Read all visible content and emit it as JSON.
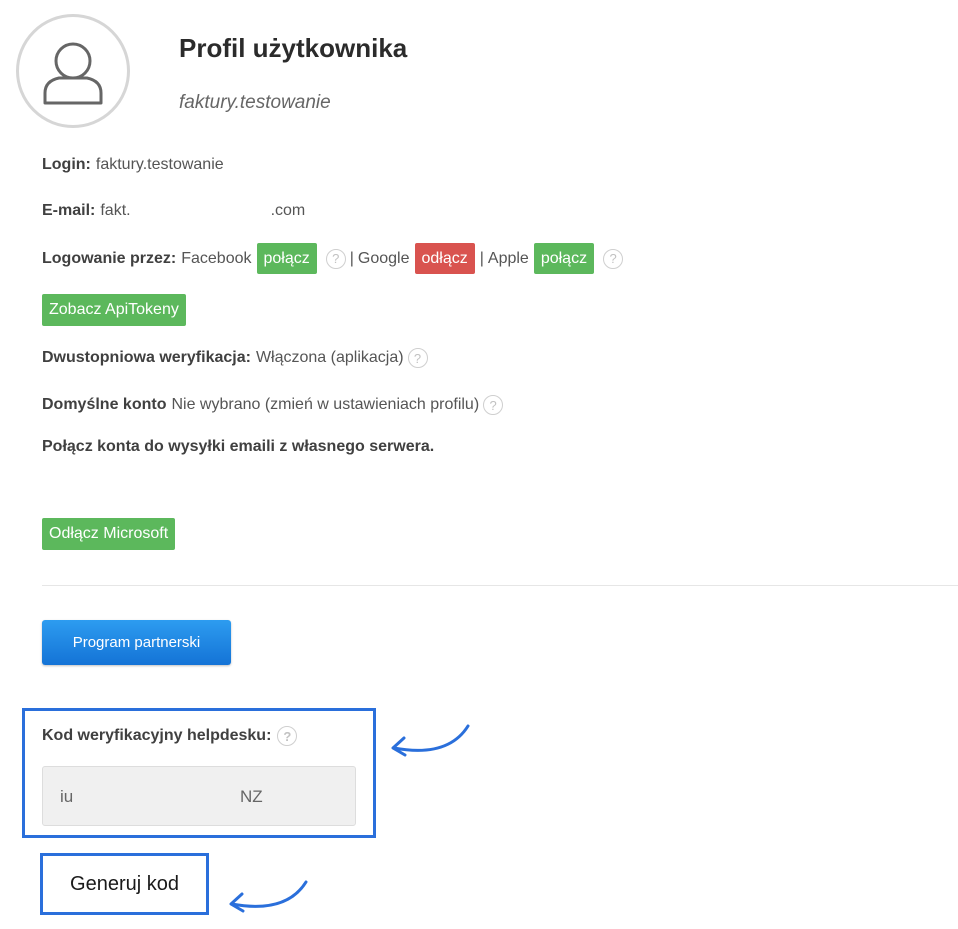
{
  "profile": {
    "title": "Profil użytkownika",
    "username": "faktury.testowanie"
  },
  "login": {
    "label": "Login:",
    "value": "faktury.testowanie"
  },
  "email": {
    "label": "E-mail:",
    "value_start": "fakt.",
    "value_end": ".com"
  },
  "social_login": {
    "label": "Logowanie przez:",
    "facebook": {
      "name": "Facebook",
      "button": "połącz",
      "color": "#5cb85c"
    },
    "separator": "|",
    "google": {
      "name": "Google",
      "button": "odłącz",
      "color": "#d9534f"
    },
    "apple": {
      "name": "Apple",
      "button": "połącz",
      "color": "#5cb85c"
    }
  },
  "api_tokens_button": "Zobacz ApiTokeny",
  "two_factor": {
    "label": "Dwustopniowa weryfikacja:",
    "value": "Włączona (aplikacja)"
  },
  "default_account": {
    "label": "Domyślne konto",
    "value": "Nie wybrano (zmień w ustawieniach profilu)"
  },
  "mail_accounts_heading": "Połącz konta do wysyłki emaili z własnego serwera.",
  "disconnect_microsoft_button": "Odłącz Microsoft",
  "partner_program_button": "Program partnerski",
  "helpdesk": {
    "label": "Kod weryfikacyjny helpdesku:",
    "code_part1": "iu",
    "code_part2": "NZ",
    "generate_button": "Generuj kod"
  },
  "help_glyph": "?",
  "colors": {
    "highlight": "#2a6fdb",
    "green": "#5cb85c",
    "red": "#d9534f",
    "blue": "#1a86e6"
  }
}
